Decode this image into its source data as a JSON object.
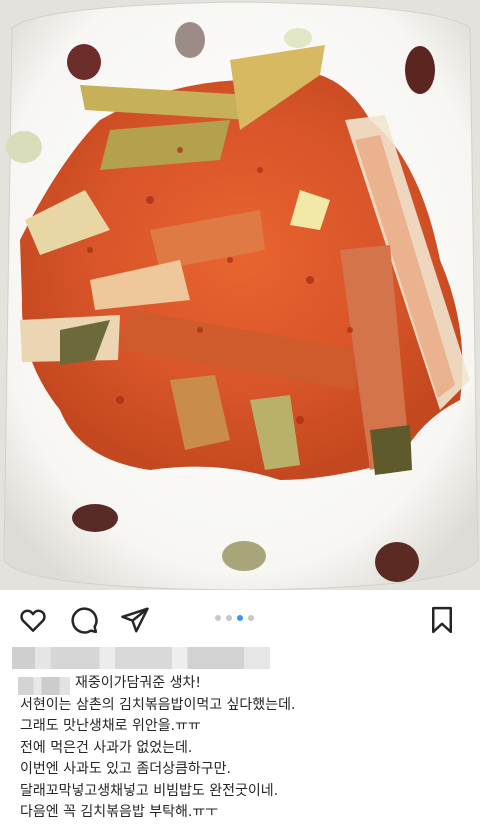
{
  "post": {
    "image_alt": "김치볶음 생채 반찬 사진",
    "carousel": {
      "count": 4,
      "active": 3
    },
    "actions": {
      "like_icon": "heart-icon",
      "comment_icon": "comment-icon",
      "share_icon": "paper-plane-icon",
      "save_icon": "bookmark-icon"
    },
    "caption_lines": [
      "재중이가담궈준 생차!",
      "서현이는 삼촌의 김치볶음밥이먹고 싶다했는데.",
      "그래도 맛난생채로 위안을.ㅠㅠ",
      "전에 먹은건 사과가 없었는데.",
      "이번엔 사과도 있고 좀더상큼하구만.",
      "달래꼬막넣고생채넣고 비빔밥도 완전굿이네.",
      "다음엔 꼭 김치볶음밥 부탁해.ㅠㅜ"
    ]
  },
  "colors": {
    "accent": "#3897f0",
    "text": "#262626",
    "dot_inactive": "#c7c7c7"
  }
}
